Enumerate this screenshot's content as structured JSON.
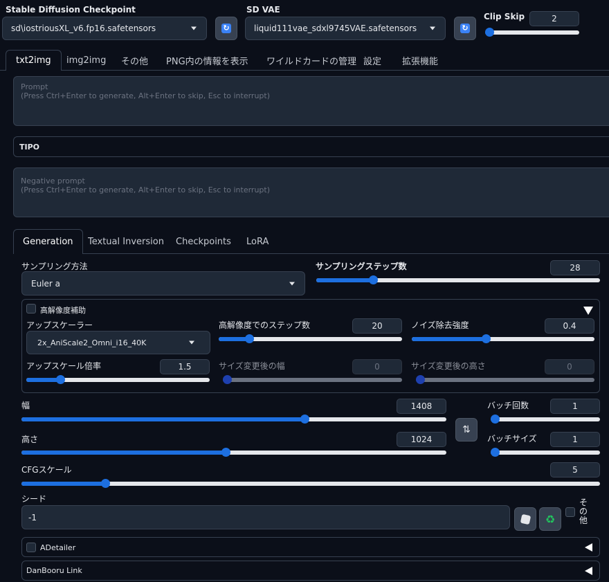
{
  "header": {
    "checkpoint": {
      "label": "Stable Diffusion Checkpoint",
      "value": "sd\\iostriousXL_v6.fp16.safetensors"
    },
    "vae": {
      "label": "SD VAE",
      "value": "liquid111vae_sdxl9745VAE.safetensors"
    },
    "clip_skip": {
      "label": "Clip Skip",
      "value": "2",
      "level": 0.0
    }
  },
  "main_tabs": [
    "txt2img",
    "img2img",
    "その他",
    "PNG内の情報を表示",
    "ワイルドカードの管理",
    "設定",
    "拡張機能"
  ],
  "prompt": {
    "placeholder_line1": "Prompt",
    "placeholder_line2": "(Press Ctrl+Enter to generate, Alt+Enter to skip, Esc to interrupt)"
  },
  "tipo": {
    "label": "TIPO"
  },
  "negative_prompt": {
    "placeholder_line1": "Negative prompt",
    "placeholder_line2": "(Press Ctrl+Enter to generate, Alt+Enter to skip, Esc to interrupt)"
  },
  "sub_tabs": [
    "Generation",
    "Textual Inversion",
    "Checkpoints",
    "LoRA"
  ],
  "sampler": {
    "label": "サンプリング方法",
    "value": "Euler a"
  },
  "steps": {
    "label": "サンプリングステップ数",
    "value": "28",
    "level": 0.19
  },
  "hires": {
    "label": "高解像度補助",
    "upscaler": {
      "label": "アップスケーラー",
      "value": "2x_AniScale2_Omni_i16_40K"
    },
    "hires_steps": {
      "label": "高解像度でのステップ数",
      "value": "20",
      "level": 0.15
    },
    "denoise": {
      "label": "ノイズ除去強度",
      "value": "0.4",
      "level": 0.4
    },
    "upscale_by": {
      "label": "アップスケール倍率",
      "value": "1.5",
      "level": 0.17
    },
    "resize_w": {
      "label": "サイズ変更後の幅",
      "value": "0",
      "level": 0.0
    },
    "resize_h": {
      "label": "サイズ変更後の高さ",
      "value": "0",
      "level": 0.0
    }
  },
  "width": {
    "label": "幅",
    "value": "1408",
    "level": 0.67
  },
  "height": {
    "label": "高さ",
    "value": "1024",
    "level": 0.48
  },
  "batch_count": {
    "label": "バッチ回数",
    "value": "1",
    "level": 0.0
  },
  "batch_size": {
    "label": "バッチサイズ",
    "value": "1",
    "level": 0.0
  },
  "cfg": {
    "label": "CFGスケール",
    "value": "5",
    "level": 0.14
  },
  "seed": {
    "label": "シード",
    "value": "-1",
    "extra_label": "その他"
  },
  "adetailer": {
    "label": "ADetailer"
  },
  "danbooru": {
    "label": "DanBooru Link"
  },
  "colors": {
    "accent": "#1d6fe0",
    "background": "#0b0f19",
    "panel": "#1f2937"
  }
}
